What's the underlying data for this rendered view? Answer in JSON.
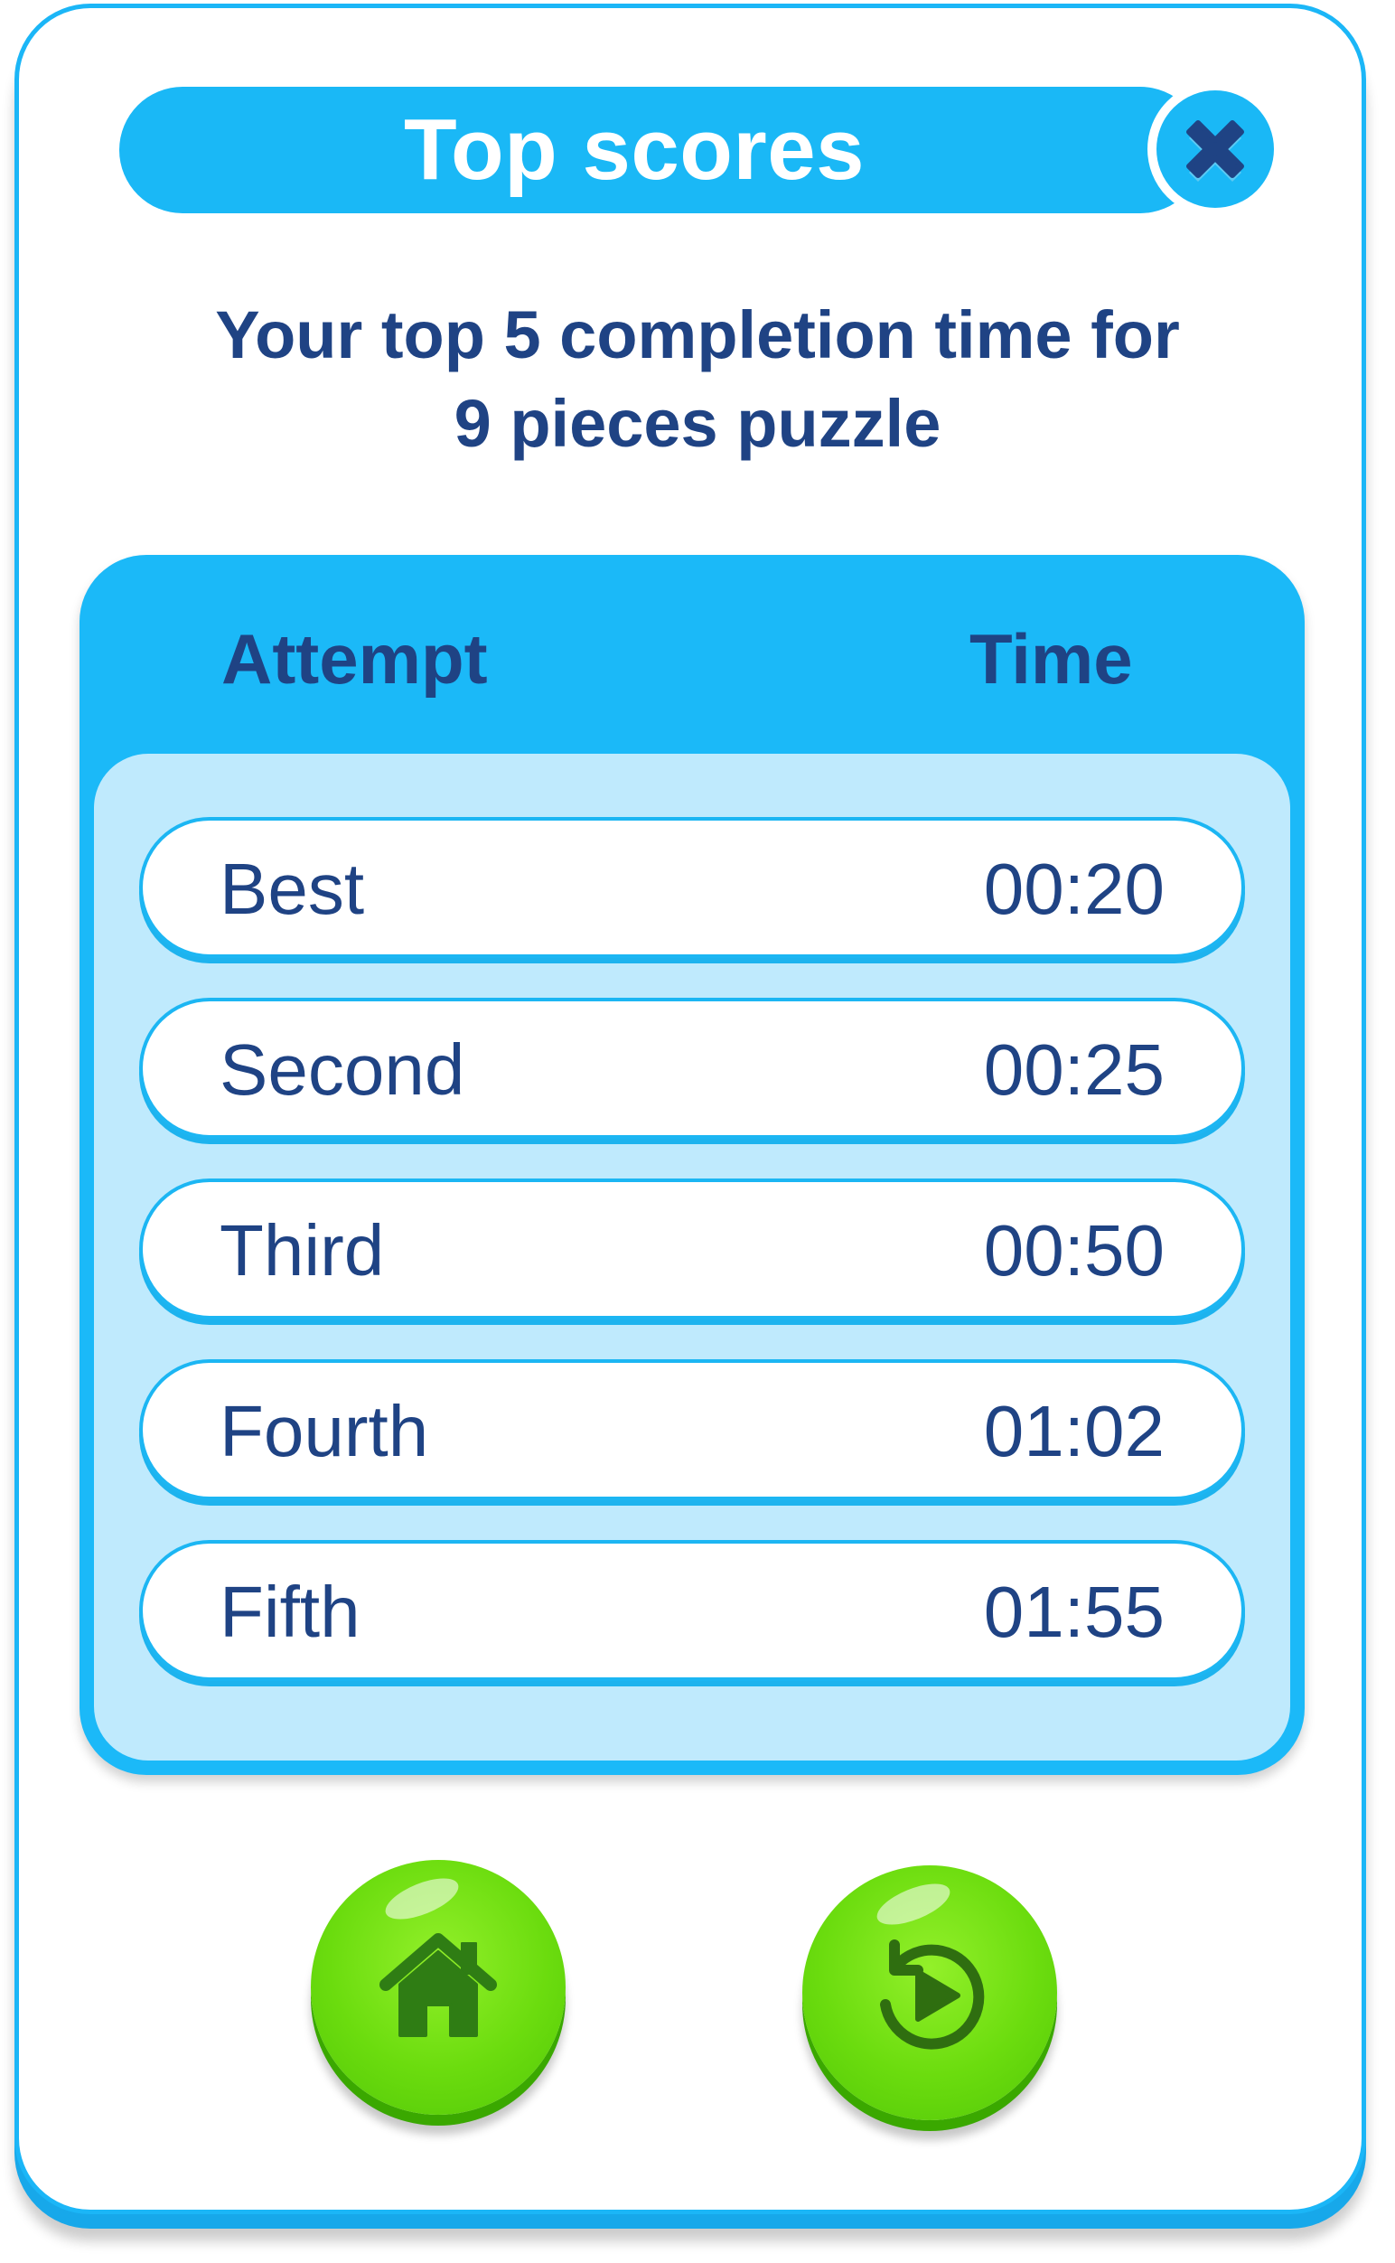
{
  "dialog": {
    "title": "Top scores",
    "subtitle_line1": "Your top 5 completion time for",
    "subtitle_line2": "9 pieces puzzle",
    "close_icon": "close-x-icon"
  },
  "table": {
    "headers": {
      "attempt": "Attempt",
      "time": "Time"
    },
    "rows": [
      {
        "label": "Best",
        "time": "00:20"
      },
      {
        "label": "Second",
        "time": "00:25"
      },
      {
        "label": "Third",
        "time": "00:50"
      },
      {
        "label": "Fourth",
        "time": "01:02"
      },
      {
        "label": "Fifth",
        "time": "01:55"
      }
    ]
  },
  "actions": {
    "home_icon": "home-icon",
    "replay_icon": "replay-icon"
  },
  "colors": {
    "primary_blue": "#1ab8f6",
    "dark_text": "#1f4384",
    "light_panel": "#bfeafd",
    "green_button": "#6bdc0e"
  }
}
